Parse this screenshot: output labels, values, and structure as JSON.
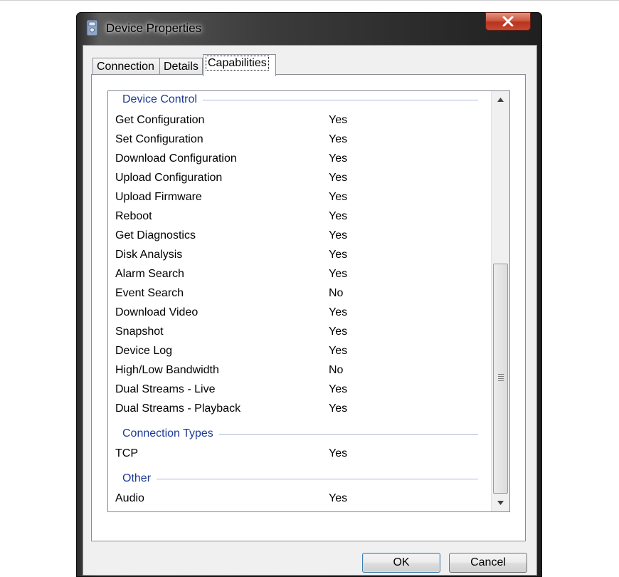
{
  "window": {
    "title": "Device Properties"
  },
  "tabs": [
    {
      "label": "Connection"
    },
    {
      "label": "Details"
    },
    {
      "label": "Capabilities"
    }
  ],
  "capabilities": {
    "groups": [
      {
        "title": "Device Control",
        "items": [
          {
            "name": "Get Configuration",
            "value": "Yes"
          },
          {
            "name": "Set Configuration",
            "value": "Yes"
          },
          {
            "name": "Download Configuration",
            "value": "Yes"
          },
          {
            "name": "Upload Configuration",
            "value": "Yes"
          },
          {
            "name": "Upload Firmware",
            "value": "Yes"
          },
          {
            "name": "Reboot",
            "value": "Yes"
          },
          {
            "name": "Get Diagnostics",
            "value": "Yes"
          },
          {
            "name": "Disk Analysis",
            "value": "Yes"
          },
          {
            "name": "Alarm Search",
            "value": "Yes"
          },
          {
            "name": "Event Search",
            "value": "No"
          },
          {
            "name": "Download Video",
            "value": "Yes"
          },
          {
            "name": "Snapshot",
            "value": "Yes"
          },
          {
            "name": "Device Log",
            "value": "Yes"
          },
          {
            "name": "High/Low Bandwidth",
            "value": "No"
          },
          {
            "name": "Dual Streams - Live",
            "value": "Yes"
          },
          {
            "name": "Dual Streams - Playback",
            "value": "Yes"
          }
        ]
      },
      {
        "title": "Connection Types",
        "items": [
          {
            "name": "TCP",
            "value": "Yes"
          }
        ]
      },
      {
        "title": "Other",
        "items": [
          {
            "name": "Audio",
            "value": "Yes"
          }
        ]
      }
    ]
  },
  "buttons": {
    "ok": "OK",
    "cancel": "Cancel"
  },
  "colors": {
    "group_header": "#1e3a96",
    "close_button": "#c64a33",
    "focus_border": "#3c7fb1"
  },
  "icons": [
    "device-properties-icon",
    "close-icon",
    "scroll-up-arrow-icon",
    "scroll-down-arrow-icon",
    "scroll-grip-icon"
  ]
}
